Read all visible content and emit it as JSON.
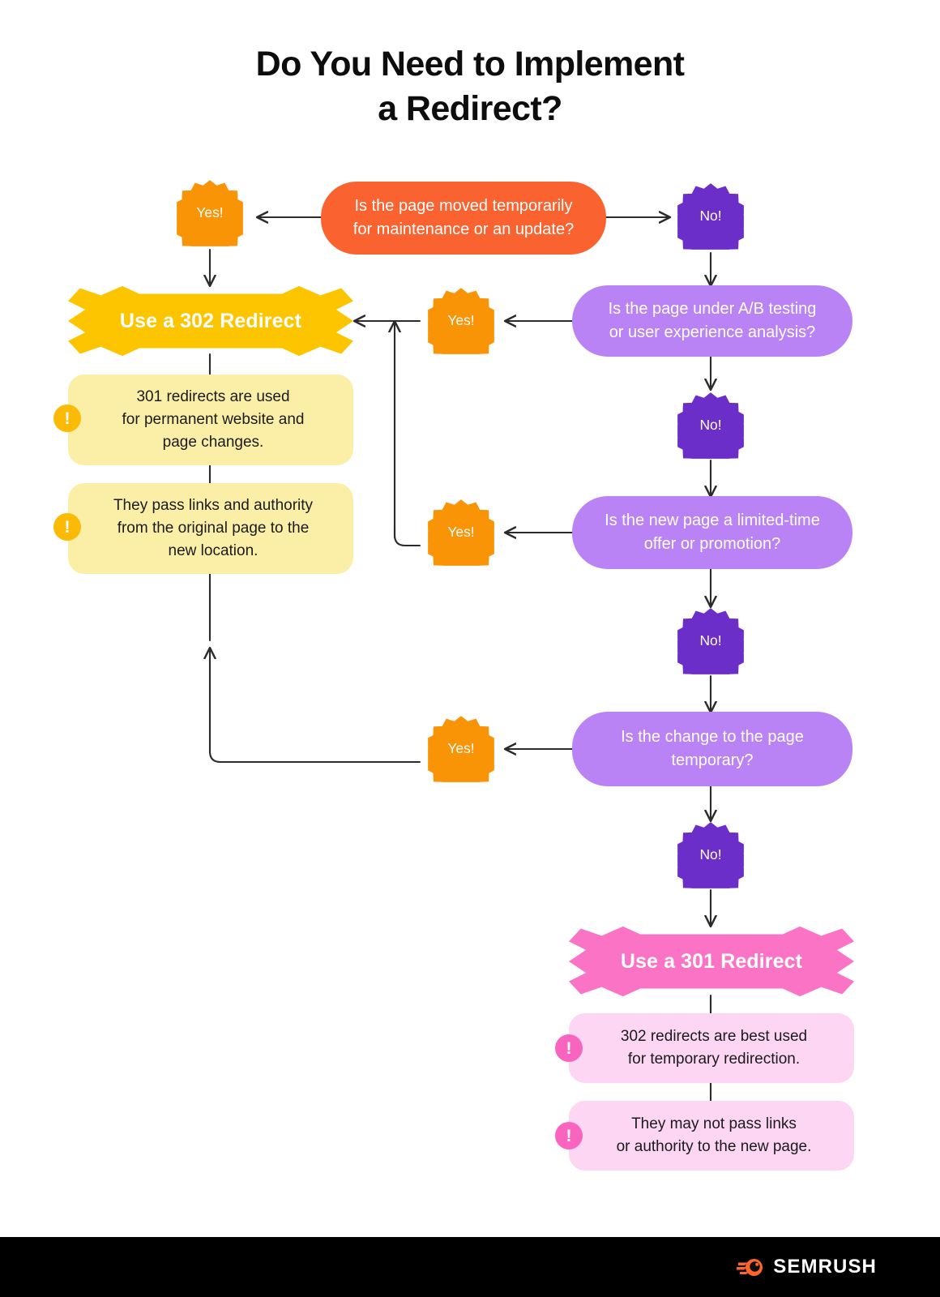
{
  "title": "Do You Need to Implement\na Redirect?",
  "title_line1": "Do You Need to Implement",
  "title_line2": "a Redirect?",
  "colors": {
    "question_start": "#FA622F",
    "question": "#B983F5",
    "yes_badge": "#F99407",
    "no_badge": "#6B2EC9",
    "result_302": "#FDC500",
    "result_301": "#FB73C5",
    "note_302": "#FBEFA8",
    "note_301": "#FCD6F2",
    "bang_302": "#FBBA05",
    "bang_301": "#F965BE",
    "footer": "#000000",
    "logo": "#FF642D",
    "connector": "#2b2b2b",
    "background": "#FFFFFF"
  },
  "badges": {
    "yes": "Yes!",
    "no": "No!"
  },
  "questions": [
    {
      "id": "q1",
      "text": "Is the page moved temporarily\nfor maintenance or an update?",
      "line1": "Is the page moved temporarily",
      "line2": "for maintenance or an update?"
    },
    {
      "id": "q2",
      "text": "Is the page under A/B testing\nor user experience analysis?",
      "line1": "Is the page under A/B testing",
      "line2": "or user experience analysis?"
    },
    {
      "id": "q3",
      "text": "Is the new page a limited-time\noffer or promotion?",
      "line1": "Is the new page a limited-time",
      "line2": "offer or promotion?"
    },
    {
      "id": "q4",
      "text": "Is the change to the page\ntemporary?",
      "line1": "Is the change to the page",
      "line2": "temporary?"
    }
  ],
  "results": {
    "redirect_302": {
      "label": "Use a 302 Redirect",
      "notes": [
        {
          "icon": "exclamation-icon",
          "text": "301 redirects are used\nfor permanent website and\npage changes.",
          "line1": "301 redirects are used",
          "line2": "for permanent website and",
          "line3": "page changes."
        },
        {
          "icon": "exclamation-icon",
          "text": "They pass links and authority\nfrom the original page to the\nnew location.",
          "line1": "They pass links and authority",
          "line2": "from the original page to the",
          "line3": "new location."
        }
      ]
    },
    "redirect_301": {
      "label": "Use a 301 Redirect",
      "notes": [
        {
          "icon": "exclamation-icon",
          "text": "302 redirects are best used\nfor temporary redirection.",
          "line1": "302 redirects are best used",
          "line2": "for temporary redirection.",
          "line3": ""
        },
        {
          "icon": "exclamation-icon",
          "text": "They may not pass links\nor authority to the new page.",
          "line1": "They may not pass links",
          "line2": "or authority to the new page.",
          "line3": ""
        }
      ]
    }
  },
  "bang_label": "!",
  "footer": {
    "brand": "SEMRUSH",
    "logo_icon": "semrush-comet-icon"
  }
}
